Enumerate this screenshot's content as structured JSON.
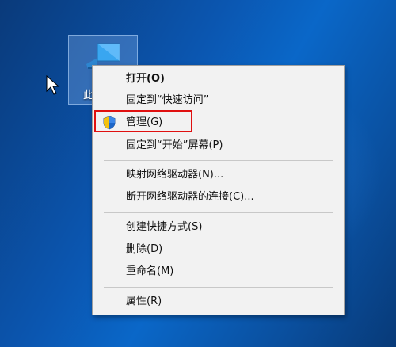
{
  "desktop": {
    "icon_label": "此"
  },
  "context_menu": {
    "items": [
      {
        "label": "打开(O)"
      },
      {
        "label": "固定到“快速访问”"
      },
      {
        "label": "管理(G)"
      },
      {
        "label": "固定到“开始”屏幕(P)"
      },
      {
        "label": "映射网络驱动器(N)..."
      },
      {
        "label": "断开网络驱动器的连接(C)..."
      },
      {
        "label": "创建快捷方式(S)"
      },
      {
        "label": "删除(D)"
      },
      {
        "label": "重命名(M)"
      },
      {
        "label": "属性(R)"
      }
    ]
  },
  "colors": {
    "highlight_border": "#e01010",
    "menu_bg": "#f2f2f2"
  }
}
